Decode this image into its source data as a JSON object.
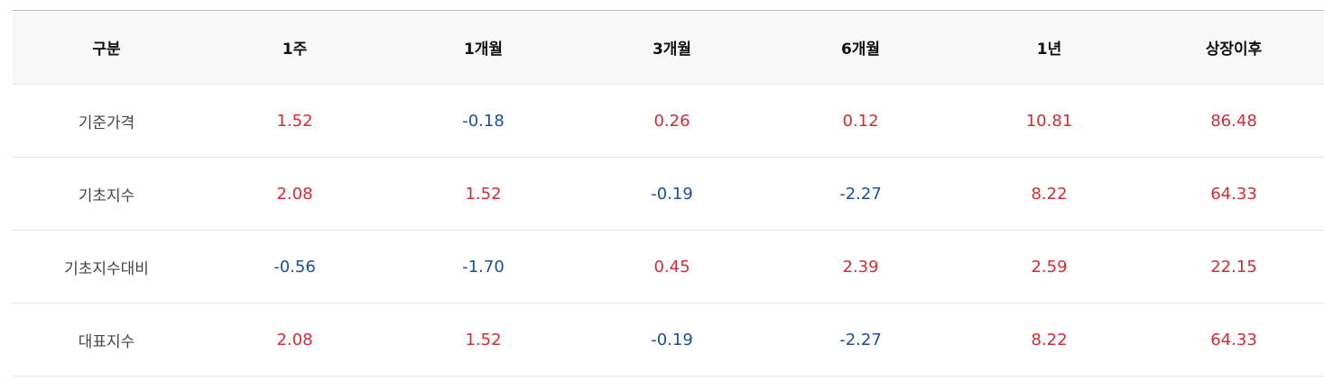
{
  "table": {
    "headers": [
      "구분",
      "1주",
      "1개월",
      "3개월",
      "6개월",
      "1년",
      "상장이후"
    ],
    "rows": [
      {
        "label": "기준가격",
        "values": [
          "1.52",
          "-0.18",
          "0.26",
          "0.12",
          "10.81",
          "86.48"
        ],
        "signs": [
          "pos",
          "neg",
          "pos",
          "pos",
          "pos",
          "pos"
        ]
      },
      {
        "label": "기초지수",
        "values": [
          "2.08",
          "1.52",
          "-0.19",
          "-2.27",
          "8.22",
          "64.33"
        ],
        "signs": [
          "pos",
          "pos",
          "neg",
          "neg",
          "pos",
          "pos"
        ]
      },
      {
        "label": "기초지수대비",
        "values": [
          "-0.56",
          "-1.70",
          "0.45",
          "2.39",
          "2.59",
          "22.15"
        ],
        "signs": [
          "neg",
          "neg",
          "pos",
          "pos",
          "pos",
          "pos"
        ]
      },
      {
        "label": "대표지수",
        "values": [
          "2.08",
          "1.52",
          "-0.19",
          "-2.27",
          "8.22",
          "64.33"
        ],
        "signs": [
          "pos",
          "pos",
          "neg",
          "neg",
          "pos",
          "pos"
        ]
      }
    ]
  },
  "colors": {
    "positive": "#d92b34",
    "negative": "#1a4fa0",
    "header_bg": "#f8f8f8"
  }
}
